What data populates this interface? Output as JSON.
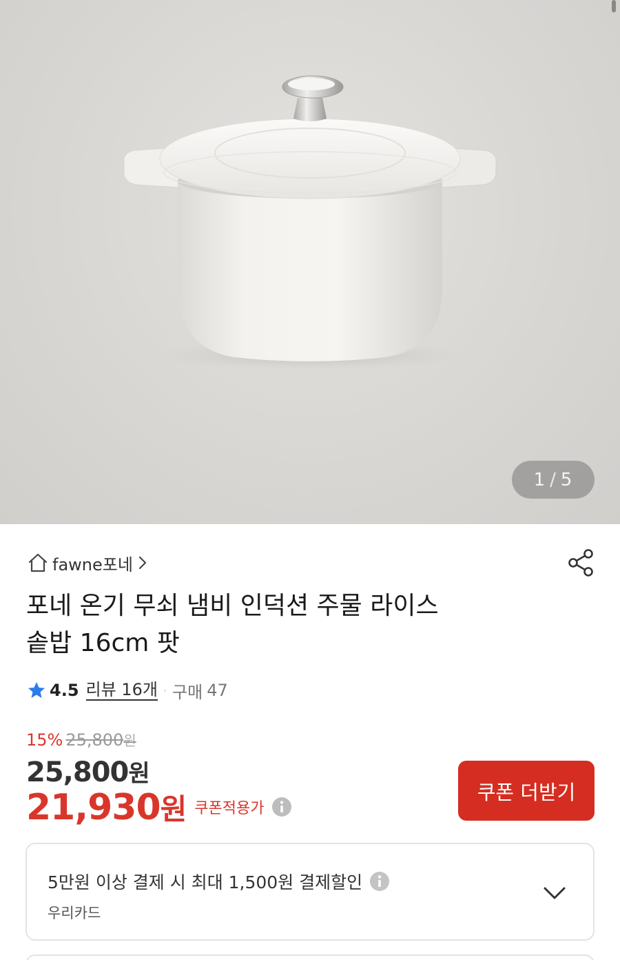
{
  "gallery": {
    "current": "1",
    "separator": "/",
    "total": "5",
    "image_icon": "white-cast-iron-rice-pot-image"
  },
  "seller": {
    "name": "fawne포네",
    "home_icon": "home-icon",
    "chevron_icon": "chevron-right-icon",
    "share_icon": "share-icon"
  },
  "product": {
    "title_line1": "포네 온기 무쇠 냄비 인덕션 주물 라이스",
    "title_line2": "솥밥 16cm 팟"
  },
  "rating": {
    "value": "4.5",
    "review_label": "리뷰 16개",
    "dot": "·",
    "purchase_label": "구매",
    "purchase_count": "47",
    "star_color": "#2b7de9"
  },
  "price": {
    "discount_rate": "15%",
    "original_price": "25,800",
    "original_unit": "원",
    "sale_price": "25,800",
    "sale_unit": "원",
    "coupon_price": "21,930",
    "coupon_unit": "원",
    "coupon_applied_label": "쿠폰적용가",
    "accent_color": "#d9362b"
  },
  "coupon_button": {
    "label": "쿠폰 더받기",
    "color": "#d52d21"
  },
  "card_promo": {
    "title": "5만원 이상 결제 시 최대 1,500원 결제할인",
    "card_name": "우리카드",
    "chevron_icon": "chevron-down-icon"
  }
}
